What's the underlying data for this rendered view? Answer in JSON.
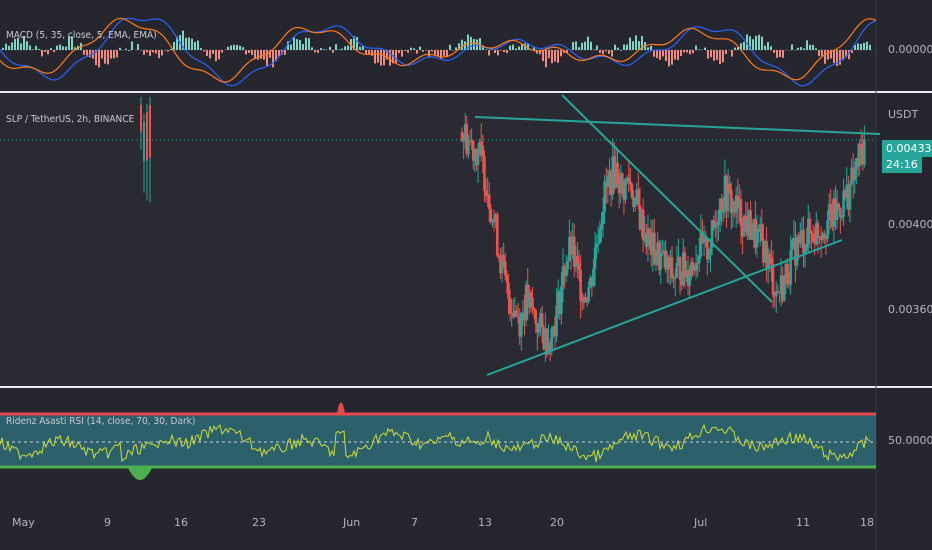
{
  "chart_data": [
    {
      "type": "line",
      "title": "MACD (5, 35, close, 5, EMA, EMA)",
      "yticks": [
        "0.00000"
      ]
    },
    {
      "type": "line",
      "title": "SLP / TetherUS, 2h, BINANCE",
      "currency": "USDT",
      "yticks": [
        "0.00400",
        "0.00360"
      ],
      "last_price": "0.00433",
      "countdown": "24:16",
      "series": [
        {
          "values": [
            0.00436,
            0.00433,
            0.0043,
            0.00426,
            0.00415,
            0.00402,
            0.00388,
            0.00375,
            0.0037,
            0.00365,
            0.00372,
            0.00368,
            0.00362,
            0.00358,
            0.0036,
            0.0037,
            0.00385,
            0.00392,
            0.00382,
            0.00375,
            0.00378,
            0.00395,
            0.0041,
            0.00418,
            0.00422,
            0.00414,
            0.00418,
            0.0041,
            0.00402,
            0.00395,
            0.0039,
            0.00388,
            0.00384,
            0.00381,
            0.00385,
            0.00383,
            0.00387,
            0.00392,
            0.0039,
            0.00396,
            0.00408,
            0.00413,
            0.00409,
            0.00406,
            0.00402,
            0.004,
            0.00395,
            0.00393,
            0.00385,
            0.00375,
            0.00378,
            0.00385,
            0.00392,
            0.00395,
            0.00397,
            0.00398,
            0.004,
            0.00402,
            0.00404,
            0.00408,
            0.00412,
            0.00418,
            0.00426,
            0.00433
          ]
        }
      ]
    },
    {
      "type": "line",
      "title": "Ridenz Asasti RSI (14, close, 70, 30, Dark)",
      "yticks": [
        "50.00000"
      ],
      "overbought": 70,
      "oversold": 30
    }
  ],
  "x_axis": {
    "ticks": [
      "May",
      "9",
      "16",
      "23",
      "Jun",
      "7",
      "13",
      "20",
      "Jul",
      "11",
      "18"
    ]
  },
  "colors": {
    "accent": "#26a69a",
    "up": "#26a69a",
    "down": "#ef5350",
    "rsi": "#cddc39",
    "ob": "#e5484d",
    "os": "#4caf50"
  }
}
